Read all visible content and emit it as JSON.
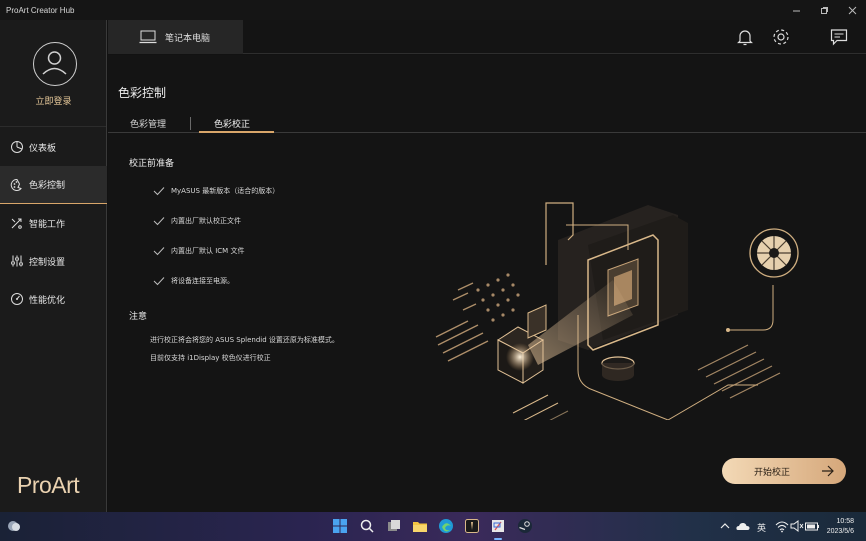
{
  "window": {
    "title": "ProArt Creator Hub"
  },
  "sidebar": {
    "login_label": "立即登录",
    "items": [
      {
        "label": "仪表板",
        "icon": "dashboard-icon"
      },
      {
        "label": "色彩控制",
        "icon": "color-palette-icon",
        "active": true
      },
      {
        "label": "智能工作",
        "icon": "smart-work-icon"
      },
      {
        "label": "控制设置",
        "icon": "sliders-icon"
      },
      {
        "label": "性能优化",
        "icon": "performance-icon"
      }
    ],
    "logo": "ProArt"
  },
  "header": {
    "device_tab": "笔记本电脑"
  },
  "main": {
    "title": "色彩控制",
    "tabs": [
      {
        "label": "色彩管理",
        "active": false
      },
      {
        "label": "色彩校正",
        "active": true
      }
    ],
    "prep_heading": "校正前准备",
    "checklist": [
      "MyASUS 最新版本（适合的版本）",
      "内置出厂默认校正文件",
      "内置出厂默认 ICM 文件",
      "将设备连接至电源。"
    ],
    "notice_heading": "注意",
    "notices": [
      "进行校正将会将您的 ASUS Splendid 设置还原为标准模式。",
      "目前仅支持 i1Display 校色仪进行校正"
    ],
    "start_button": "开始校正"
  },
  "taskbar": {
    "lang": "英",
    "time": "10:58",
    "date": "2023/5/6"
  },
  "colors": {
    "accent": "#d9a66a",
    "background": "#141414"
  }
}
